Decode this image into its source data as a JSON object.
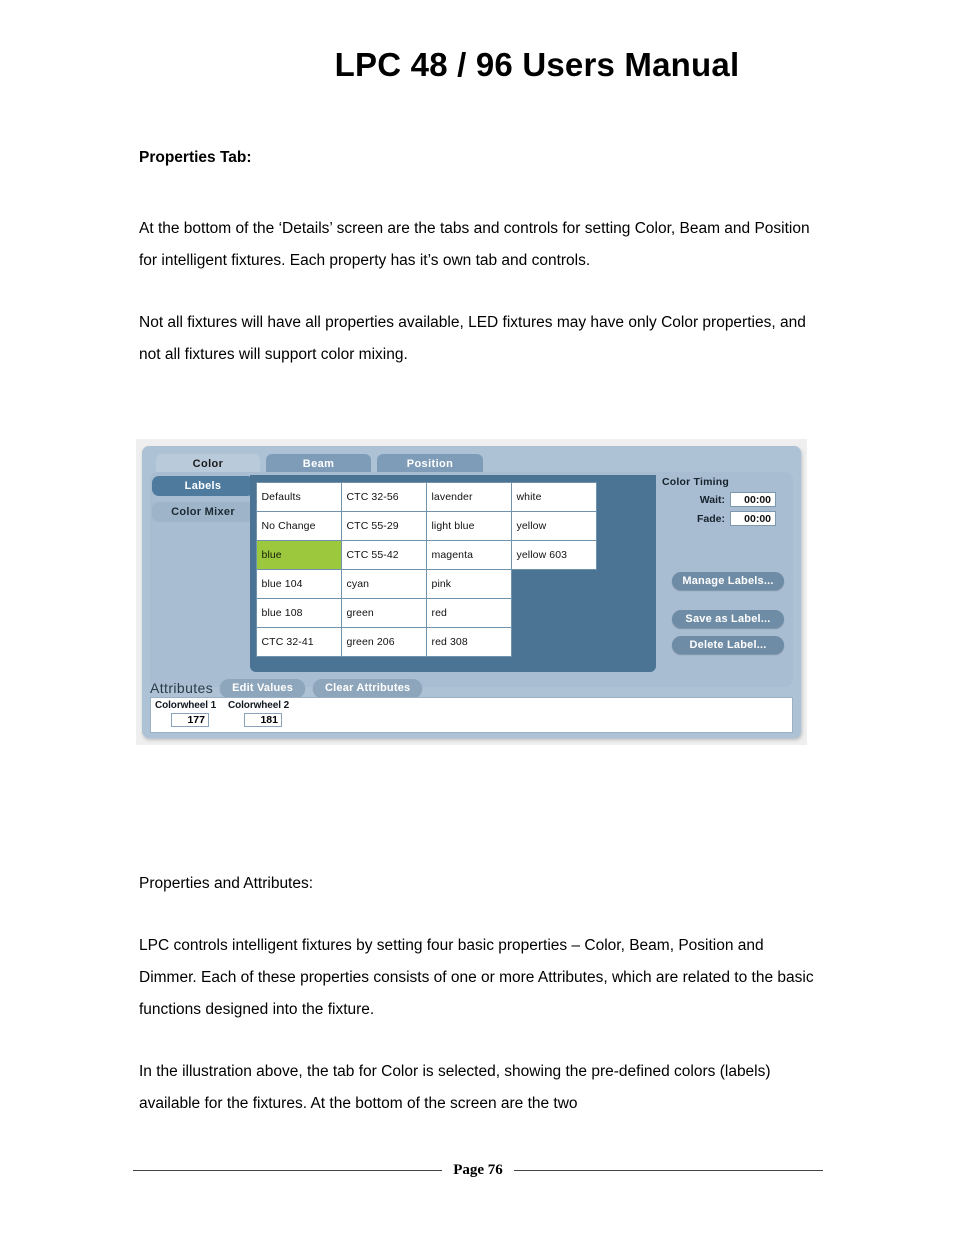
{
  "document": {
    "title": "LPC 48 / 96 Users Manual",
    "section_heading": "Properties Tab:",
    "paragraphs": [
      "At the bottom of the ‘Details’ screen are the tabs and controls for setting Color, Beam and Position for intelligent fixtures.  Each property has it’s own tab and controls.",
      "Not all fixtures will have all properties available, LED fixtures may have only Color properties, and not all fixtures will support color mixing."
    ],
    "paragraphs_after": [
      "Properties and Attributes:",
      "LPC controls intelligent fixtures by setting four basic properties – Color, Beam, Position and Dimmer. Each of these properties consists of one or more Attributes, which are related to the basic functions designed into the fixture.",
      "In the illustration above, the tab for Color is selected, showing the pre-defined colors (labels) available for the fixtures.  At the bottom of the screen are the two"
    ],
    "footer": "Page 76"
  },
  "screenshot": {
    "tabs": [
      {
        "label": "Color",
        "active": true
      },
      {
        "label": "Beam",
        "active": false
      },
      {
        "label": "Position",
        "active": false
      }
    ],
    "sidebar": [
      {
        "label": "Labels",
        "active": true
      },
      {
        "label": "Color Mixer",
        "active": false
      }
    ],
    "label_grid": {
      "columns": 4,
      "rows": [
        [
          "Defaults",
          "CTC 32-56",
          "lavender",
          "white"
        ],
        [
          "No Change",
          "CTC 55-29",
          "light blue",
          "yellow"
        ],
        [
          "blue",
          "CTC 55-42",
          "magenta",
          "yellow 603"
        ],
        [
          "blue 104",
          "cyan",
          "pink",
          ""
        ],
        [
          "blue 108",
          "green",
          "red",
          ""
        ],
        [
          "CTC 32-41",
          "green 206",
          "red 308",
          ""
        ]
      ],
      "selected": "blue",
      "selected_color": "#9bc83c"
    },
    "color_timing": {
      "title": "Color Timing",
      "wait_label": "Wait:",
      "wait_value": "00:00",
      "fade_label": "Fade:",
      "fade_value": "00:00"
    },
    "label_buttons": [
      "Manage Labels...",
      "Save as Label...",
      "Delete Label..."
    ],
    "attributes": {
      "title": "Attributes",
      "buttons": [
        "Edit Values",
        "Clear Attributes"
      ],
      "columns": [
        {
          "label": "Colorwheel 1",
          "value": "177"
        },
        {
          "label": "Colorwheel 2",
          "value": "181"
        }
      ]
    }
  }
}
